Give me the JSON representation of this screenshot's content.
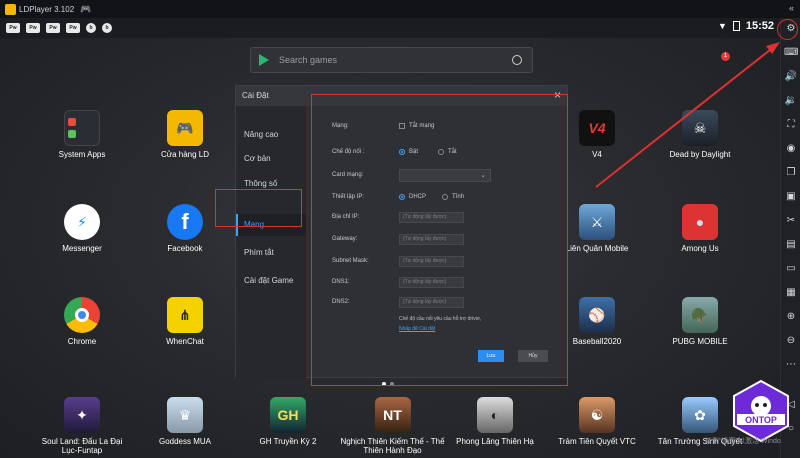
{
  "title_bar": {
    "app_name": "LDPlayer 3.102"
  },
  "status_bar": {
    "time": "15:52",
    "tiny_icons": [
      "Pw",
      "Pw",
      "Pw",
      "Pw",
      "b",
      "b"
    ]
  },
  "search": {
    "placeholder": "Search games"
  },
  "notification_badge": "1",
  "apps": [
    {
      "label": "System Apps"
    },
    {
      "label": "Cửa hàng LD"
    },
    {
      "label": "V4"
    },
    {
      "label": "Dead by Daylight"
    },
    {
      "label": "Messenger"
    },
    {
      "label": "Facebook"
    },
    {
      "label": "Liên Quân Mobile"
    },
    {
      "label": "Among Us"
    },
    {
      "label": "Chrome"
    },
    {
      "label": "WhenChat"
    },
    {
      "label": "Baseball2020"
    },
    {
      "label": "PUBG MOBILE"
    },
    {
      "label": "Soul Land: Đấu La Đại Lục-Funtap"
    },
    {
      "label": "Goddess MUA"
    },
    {
      "label": "GH Truyền Kỳ 2"
    },
    {
      "label": "Nghịch Thiên Kiếm Thế - Thế Thiên Hành Đạo"
    },
    {
      "label": "Phong Lăng Thiên Hạ"
    },
    {
      "label": "Trảm Tiên Quyết VTC"
    },
    {
      "label": "Tân Trường Sinh Quyết"
    }
  ],
  "dialog": {
    "title": "Cài Đặt",
    "nav": [
      "Nâng cao",
      "Cơ bản",
      "Thông số",
      "Mạng",
      "Phím tắt",
      "Cài đặt Game"
    ],
    "active_nav": "Mạng",
    "fields": {
      "mang_label": "Mạng:",
      "tat_mang": "Tắt mạng",
      "che_do_noi": "Chế độ nối :",
      "bat": "Bật",
      "tat": "Tắt",
      "card_mang": "Card mạng:",
      "thiet_lap_ip": "Thiết lập IP:",
      "dhcp": "DHCP",
      "tinh": "Tĩnh",
      "dia_chi_ip": "Địa chỉ IP:",
      "gateway": "Gateway:",
      "subnet": "Subnet Mask:",
      "dns1": "DNS1:",
      "dns2": "DNS2:",
      "auto_placeholder": "(Tự động lấy được)",
      "note": "Chế độ cầu nối yêu cầu hỗ trợ driver,",
      "link": "Nhấp để Cài đặt"
    },
    "save": "Lưu",
    "cancel": "Hủy"
  },
  "watermark": {
    "brand": "ONTOP",
    "windows_text": "转到\"设置\"以激活 Windo"
  },
  "colors": {
    "accent": "#3ba4ff",
    "annotation": "#e03030",
    "ld_yellow": "#f5b800"
  }
}
